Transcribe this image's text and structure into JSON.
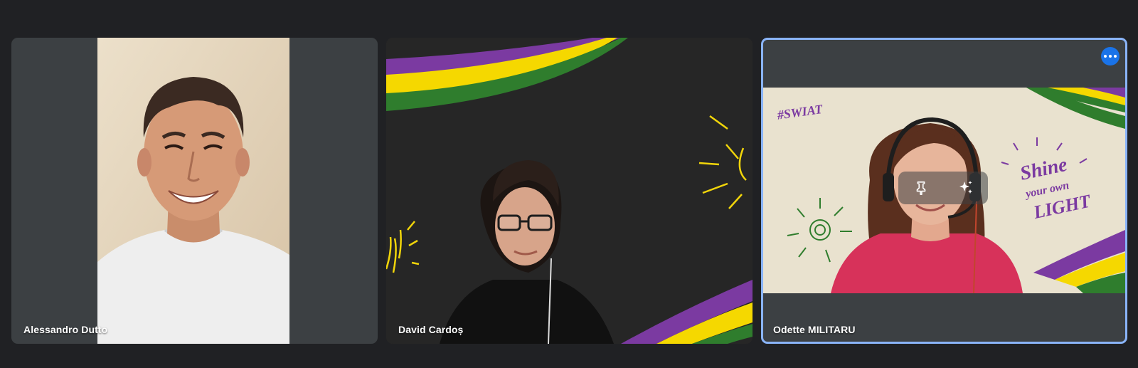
{
  "participants": [
    {
      "name": "Alessandro Dutto"
    },
    {
      "name": "David Cardoș"
    },
    {
      "name": "Odette MILITARU"
    }
  ],
  "tile3": {
    "background_text": {
      "logo": "#SWIAT",
      "slogan_line1": "Shine",
      "slogan_line2": "your own",
      "slogan_line3": "LIGHT"
    },
    "controls": [
      "pin-icon",
      "visual-effects-icon"
    ]
  },
  "colors": {
    "page_bg": "#202124",
    "tile_bg": "#3c4043",
    "active_border": "#8ab4f8",
    "more_button": "#1a73e8",
    "stripe_purple": "#7b3aa1",
    "stripe_yellow": "#f5d800",
    "stripe_green": "#2f7d2d"
  },
  "icons": {
    "more_options": "more-horizontal-icon"
  }
}
